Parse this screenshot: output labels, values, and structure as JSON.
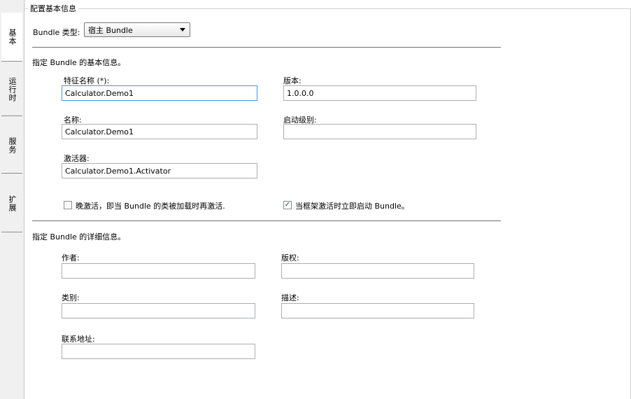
{
  "tabs": [
    {
      "label": "基本"
    },
    {
      "label": "运行时"
    },
    {
      "label": "服务"
    },
    {
      "label": "扩展"
    }
  ],
  "group_title": "配置基本信息",
  "bundle_type": {
    "label": "Bundle 类型:",
    "value": "宿主 Bundle"
  },
  "basic_section": {
    "heading": "指定 Bundle 的基本信息。",
    "feature_name": {
      "label": "特征名称 (*):",
      "value": "Calculator.Demo1"
    },
    "version": {
      "label": "版本:",
      "value": "1.0.0.0"
    },
    "name": {
      "label": "名称:",
      "value": "Calculator.Demo1"
    },
    "start_level": {
      "label": "启动级别:",
      "value": ""
    },
    "activator": {
      "label": "激活器:",
      "value": "Calculator.Demo1.Activator"
    },
    "lazy_activation": {
      "label": "晚激活，即当 Bundle 的类被加载时再激活.",
      "checked": false
    },
    "start_immediately": {
      "label": "当框架激活时立即启动 Bundle。",
      "checked": true
    }
  },
  "detail_section": {
    "heading": "指定 Bundle 的详细信息。",
    "author": {
      "label": "作者:",
      "value": ""
    },
    "copyright": {
      "label": "版权:",
      "value": ""
    },
    "category": {
      "label": "类别:",
      "value": ""
    },
    "description": {
      "label": "描述:",
      "value": ""
    },
    "contact": {
      "label": "联系地址:",
      "value": ""
    }
  },
  "colors": {
    "focus_border": "#3399ff",
    "separator": "#707070",
    "sidebar": "#f0f0f0"
  }
}
